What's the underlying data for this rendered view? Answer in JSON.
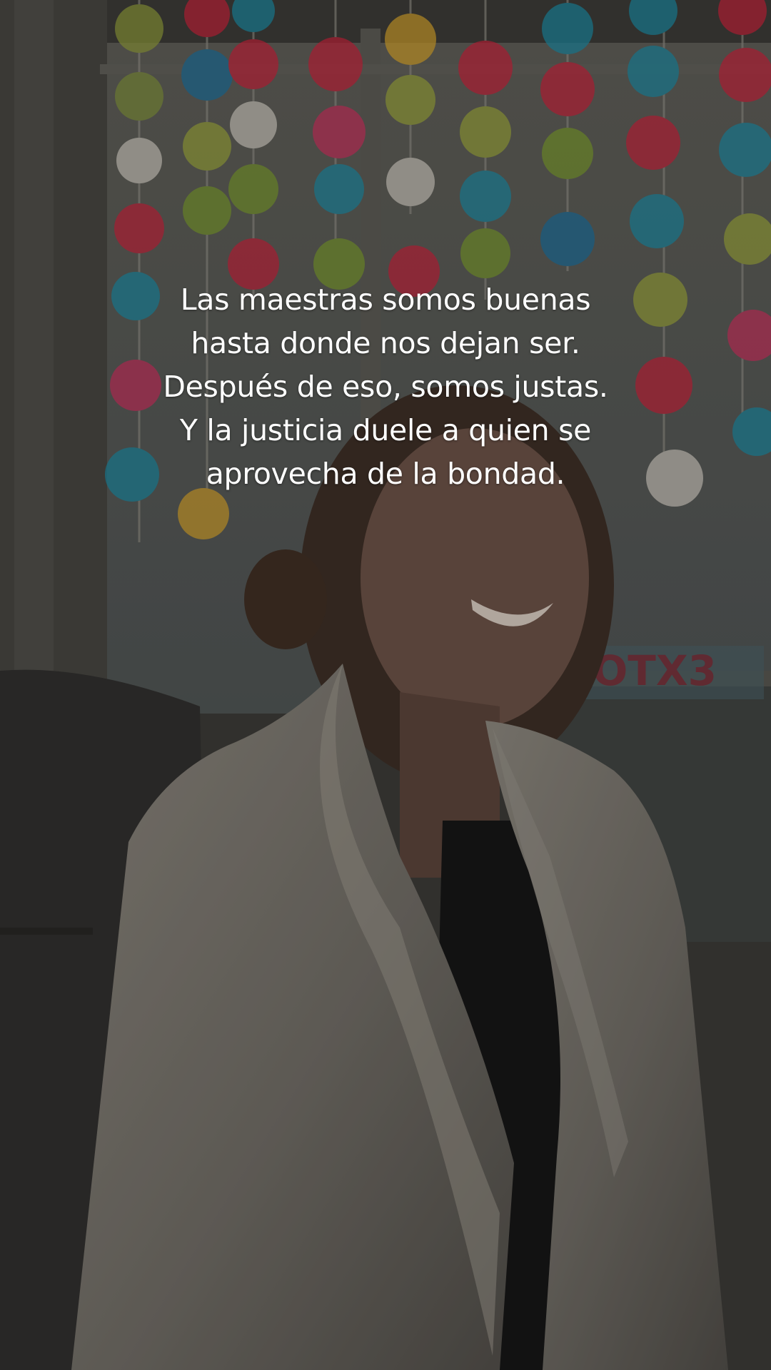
{
  "post": {
    "caption_lines": [
      "Las maestras somos buenas",
      "hasta donde nos dejan ser.",
      "Después de eso, somos justas.",
      "Y la justicia duele a quien se",
      "aprovecha de la bondad."
    ]
  },
  "background_photo": {
    "visible_sign_text": "OTX3",
    "palette": {
      "pompom_red": "#c7223a",
      "pompom_teal": "#1b8aa3",
      "pompom_green": "#7a9a2c",
      "pompom_yellow": "#d4a22a",
      "pompom_pink": "#c9305d",
      "pompom_white": "#cfcac0",
      "jacket": "#d9d4cc",
      "wall": "#6d6a62"
    }
  }
}
